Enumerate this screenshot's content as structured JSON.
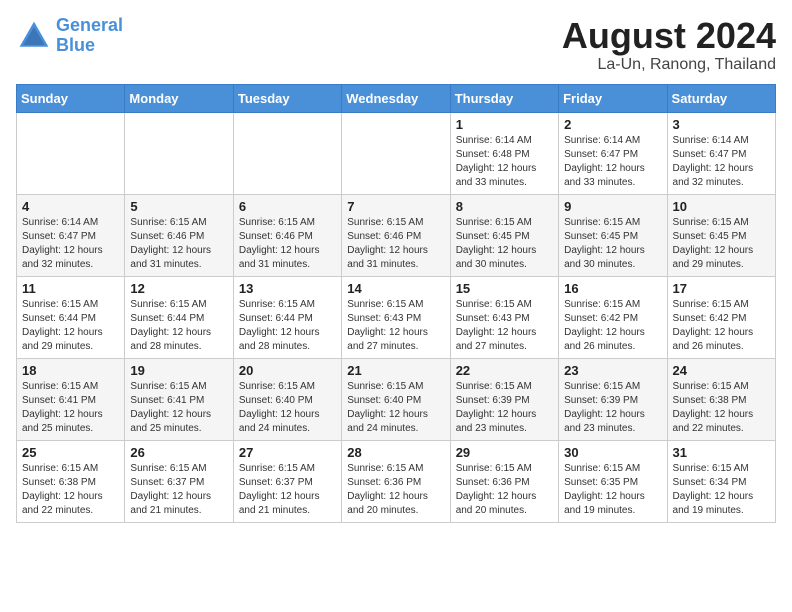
{
  "header": {
    "logo_line1": "General",
    "logo_line2": "Blue",
    "month_year": "August 2024",
    "location": "La-Un, Ranong, Thailand"
  },
  "weekdays": [
    "Sunday",
    "Monday",
    "Tuesday",
    "Wednesday",
    "Thursday",
    "Friday",
    "Saturday"
  ],
  "weeks": [
    [
      {
        "day": "",
        "info": ""
      },
      {
        "day": "",
        "info": ""
      },
      {
        "day": "",
        "info": ""
      },
      {
        "day": "",
        "info": ""
      },
      {
        "day": "1",
        "info": "Sunrise: 6:14 AM\nSunset: 6:48 PM\nDaylight: 12 hours\nand 33 minutes."
      },
      {
        "day": "2",
        "info": "Sunrise: 6:14 AM\nSunset: 6:47 PM\nDaylight: 12 hours\nand 33 minutes."
      },
      {
        "day": "3",
        "info": "Sunrise: 6:14 AM\nSunset: 6:47 PM\nDaylight: 12 hours\nand 32 minutes."
      }
    ],
    [
      {
        "day": "4",
        "info": "Sunrise: 6:14 AM\nSunset: 6:47 PM\nDaylight: 12 hours\nand 32 minutes."
      },
      {
        "day": "5",
        "info": "Sunrise: 6:15 AM\nSunset: 6:46 PM\nDaylight: 12 hours\nand 31 minutes."
      },
      {
        "day": "6",
        "info": "Sunrise: 6:15 AM\nSunset: 6:46 PM\nDaylight: 12 hours\nand 31 minutes."
      },
      {
        "day": "7",
        "info": "Sunrise: 6:15 AM\nSunset: 6:46 PM\nDaylight: 12 hours\nand 31 minutes."
      },
      {
        "day": "8",
        "info": "Sunrise: 6:15 AM\nSunset: 6:45 PM\nDaylight: 12 hours\nand 30 minutes."
      },
      {
        "day": "9",
        "info": "Sunrise: 6:15 AM\nSunset: 6:45 PM\nDaylight: 12 hours\nand 30 minutes."
      },
      {
        "day": "10",
        "info": "Sunrise: 6:15 AM\nSunset: 6:45 PM\nDaylight: 12 hours\nand 29 minutes."
      }
    ],
    [
      {
        "day": "11",
        "info": "Sunrise: 6:15 AM\nSunset: 6:44 PM\nDaylight: 12 hours\nand 29 minutes."
      },
      {
        "day": "12",
        "info": "Sunrise: 6:15 AM\nSunset: 6:44 PM\nDaylight: 12 hours\nand 28 minutes."
      },
      {
        "day": "13",
        "info": "Sunrise: 6:15 AM\nSunset: 6:44 PM\nDaylight: 12 hours\nand 28 minutes."
      },
      {
        "day": "14",
        "info": "Sunrise: 6:15 AM\nSunset: 6:43 PM\nDaylight: 12 hours\nand 27 minutes."
      },
      {
        "day": "15",
        "info": "Sunrise: 6:15 AM\nSunset: 6:43 PM\nDaylight: 12 hours\nand 27 minutes."
      },
      {
        "day": "16",
        "info": "Sunrise: 6:15 AM\nSunset: 6:42 PM\nDaylight: 12 hours\nand 26 minutes."
      },
      {
        "day": "17",
        "info": "Sunrise: 6:15 AM\nSunset: 6:42 PM\nDaylight: 12 hours\nand 26 minutes."
      }
    ],
    [
      {
        "day": "18",
        "info": "Sunrise: 6:15 AM\nSunset: 6:41 PM\nDaylight: 12 hours\nand 25 minutes."
      },
      {
        "day": "19",
        "info": "Sunrise: 6:15 AM\nSunset: 6:41 PM\nDaylight: 12 hours\nand 25 minutes."
      },
      {
        "day": "20",
        "info": "Sunrise: 6:15 AM\nSunset: 6:40 PM\nDaylight: 12 hours\nand 24 minutes."
      },
      {
        "day": "21",
        "info": "Sunrise: 6:15 AM\nSunset: 6:40 PM\nDaylight: 12 hours\nand 24 minutes."
      },
      {
        "day": "22",
        "info": "Sunrise: 6:15 AM\nSunset: 6:39 PM\nDaylight: 12 hours\nand 23 minutes."
      },
      {
        "day": "23",
        "info": "Sunrise: 6:15 AM\nSunset: 6:39 PM\nDaylight: 12 hours\nand 23 minutes."
      },
      {
        "day": "24",
        "info": "Sunrise: 6:15 AM\nSunset: 6:38 PM\nDaylight: 12 hours\nand 22 minutes."
      }
    ],
    [
      {
        "day": "25",
        "info": "Sunrise: 6:15 AM\nSunset: 6:38 PM\nDaylight: 12 hours\nand 22 minutes."
      },
      {
        "day": "26",
        "info": "Sunrise: 6:15 AM\nSunset: 6:37 PM\nDaylight: 12 hours\nand 21 minutes."
      },
      {
        "day": "27",
        "info": "Sunrise: 6:15 AM\nSunset: 6:37 PM\nDaylight: 12 hours\nand 21 minutes."
      },
      {
        "day": "28",
        "info": "Sunrise: 6:15 AM\nSunset: 6:36 PM\nDaylight: 12 hours\nand 20 minutes."
      },
      {
        "day": "29",
        "info": "Sunrise: 6:15 AM\nSunset: 6:36 PM\nDaylight: 12 hours\nand 20 minutes."
      },
      {
        "day": "30",
        "info": "Sunrise: 6:15 AM\nSunset: 6:35 PM\nDaylight: 12 hours\nand 19 minutes."
      },
      {
        "day": "31",
        "info": "Sunrise: 6:15 AM\nSunset: 6:34 PM\nDaylight: 12 hours\nand 19 minutes."
      }
    ]
  ]
}
